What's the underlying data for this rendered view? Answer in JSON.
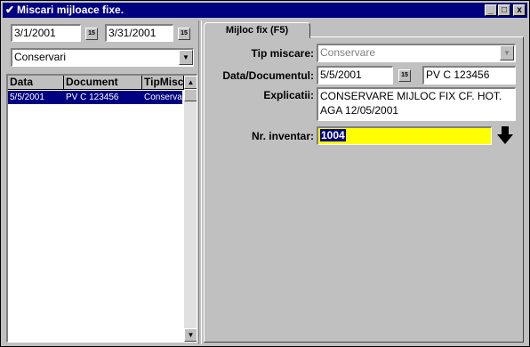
{
  "window": {
    "title": "Miscari mijloace fixe.",
    "controls": {
      "minimize": "_",
      "maximize": "□",
      "close": "x"
    }
  },
  "filters": {
    "date_from": "3/1/2001",
    "date_to": "3/31/2001",
    "calendar_label": "15",
    "type_selected": "Conservari"
  },
  "list": {
    "columns": [
      "Data",
      "Document",
      "TipMisc"
    ],
    "rows": [
      {
        "data": "5/5/2001",
        "document": "PV C 123456",
        "tip": "Conservar"
      }
    ]
  },
  "tab": {
    "label": "Mijloc fix (F5)"
  },
  "form": {
    "tip_miscare_label": "Tip miscare:",
    "tip_miscare_value": "Conservare",
    "data_doc_label": "Data/Documentul:",
    "data_value": "5/5/2001",
    "document_value": "PV C 123456",
    "explicatii_label": "Explicatii:",
    "explicatii_line1": "CONSERVARE MIJLOC FIX CF. HOT.",
    "explicatii_line2": "AGA 12/05/2001",
    "nr_inventar_label": "Nr. inventar:",
    "nr_inventar_value": "1004"
  },
  "colors": {
    "title_bar": "#000080",
    "highlight_field": "#ffff00",
    "selection": "#000080"
  }
}
